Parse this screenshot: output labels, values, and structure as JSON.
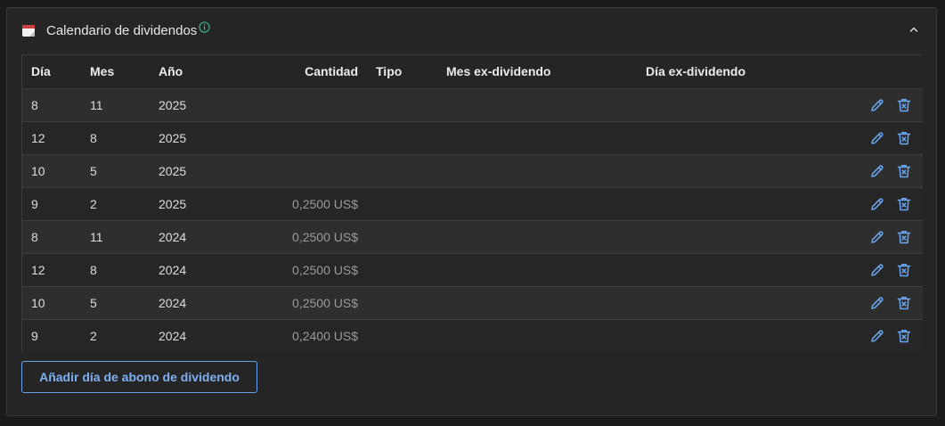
{
  "panel": {
    "title": "Calendario de dividendos",
    "icons": {
      "header": "calendar-icon",
      "info": "info-icon",
      "collapse": "chevron-up-icon"
    }
  },
  "table": {
    "headers": [
      "Día",
      "Mes",
      "Año",
      "Cantidad",
      "Tipo",
      "Mes ex-dividendo",
      "Día ex-dividendo"
    ],
    "rows": [
      {
        "dia": "8",
        "mes": "11",
        "ano": "2025",
        "cantidad": "",
        "tipo": "",
        "mes_ex": "",
        "dia_ex": ""
      },
      {
        "dia": "12",
        "mes": "8",
        "ano": "2025",
        "cantidad": "",
        "tipo": "",
        "mes_ex": "",
        "dia_ex": ""
      },
      {
        "dia": "10",
        "mes": "5",
        "ano": "2025",
        "cantidad": "",
        "tipo": "",
        "mes_ex": "",
        "dia_ex": ""
      },
      {
        "dia": "9",
        "mes": "2",
        "ano": "2025",
        "cantidad": "0,2500 US$",
        "tipo": "",
        "mes_ex": "",
        "dia_ex": ""
      },
      {
        "dia": "8",
        "mes": "11",
        "ano": "2024",
        "cantidad": "0,2500 US$",
        "tipo": "",
        "mes_ex": "",
        "dia_ex": ""
      },
      {
        "dia": "12",
        "mes": "8",
        "ano": "2024",
        "cantidad": "0,2500 US$",
        "tipo": "",
        "mes_ex": "",
        "dia_ex": ""
      },
      {
        "dia": "10",
        "mes": "5",
        "ano": "2024",
        "cantidad": "0,2500 US$",
        "tipo": "",
        "mes_ex": "",
        "dia_ex": ""
      },
      {
        "dia": "9",
        "mes": "2",
        "ano": "2024",
        "cantidad": "0,2400 US$",
        "tipo": "",
        "mes_ex": "",
        "dia_ex": ""
      }
    ],
    "row_actions": [
      "edit-icon",
      "delete-icon"
    ]
  },
  "add_button_label": "Añadir día de abono de dividendo",
  "colors": {
    "accent": "#7fb0f2",
    "info": "#3fae8a"
  }
}
